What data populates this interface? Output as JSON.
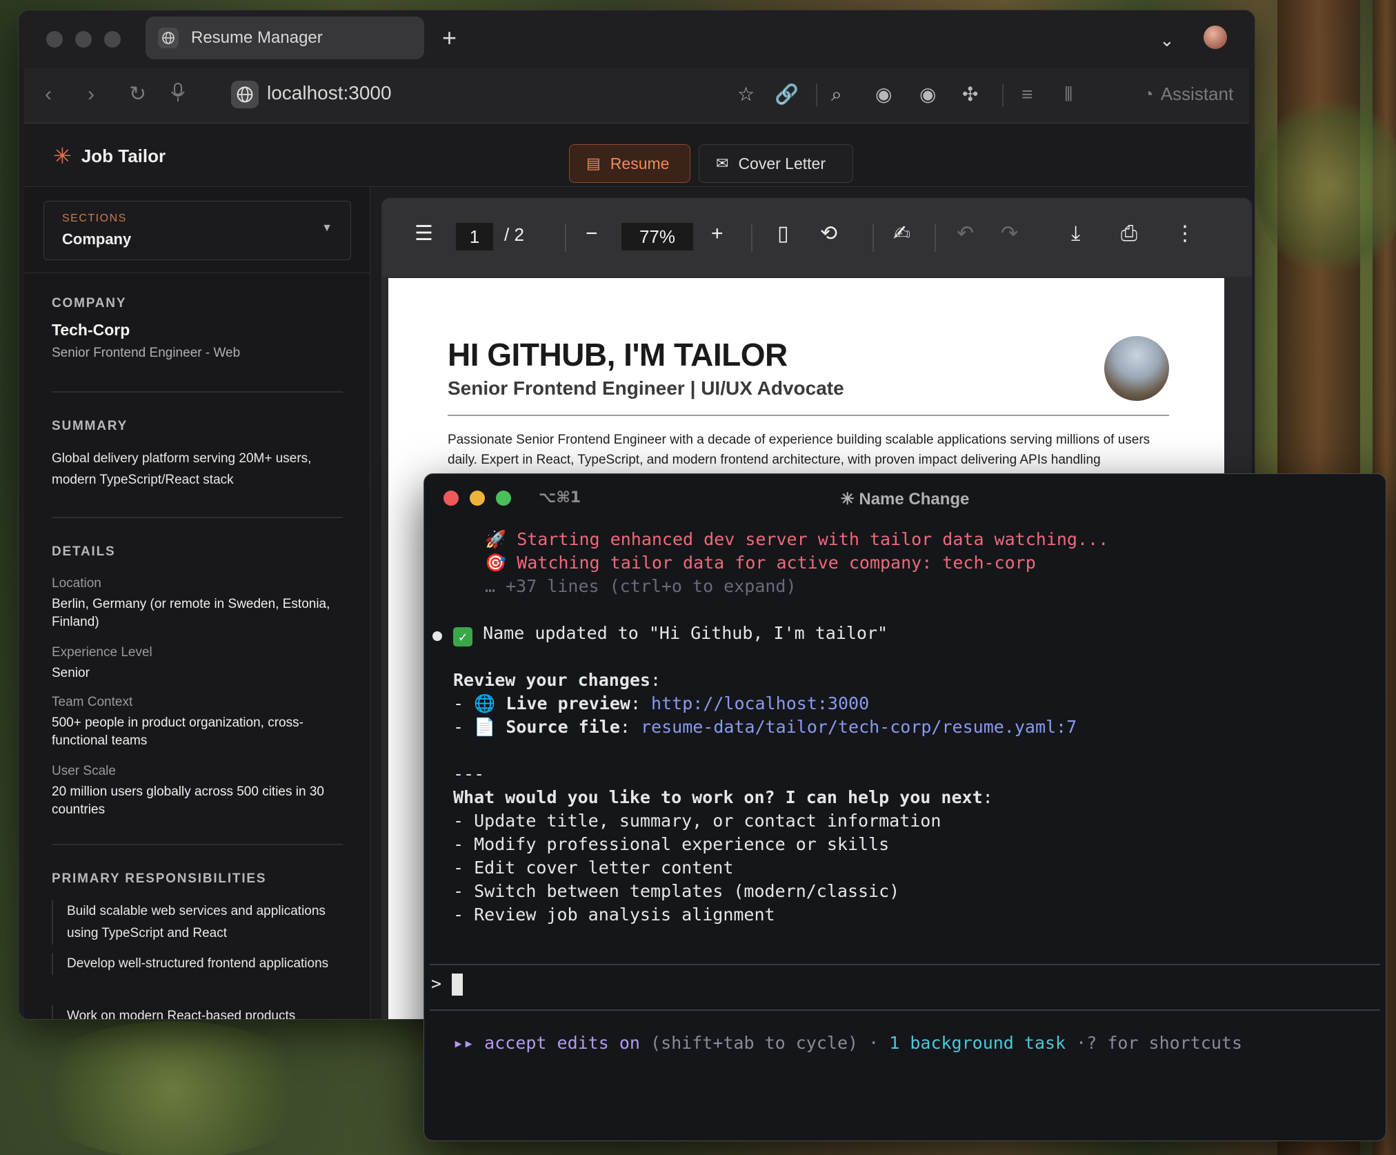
{
  "browser": {
    "tab_title": "Resume Manager",
    "new_tab": "+",
    "url": "localhost:3000",
    "assistant_label": "Assistant"
  },
  "app": {
    "brand": "Job Tailor",
    "tabs": {
      "resume": "Resume",
      "cover_letter": "Cover Letter"
    }
  },
  "sidebar": {
    "sections_label": "SECTIONS",
    "sections_value": "Company",
    "company_heading": "COMPANY",
    "company_name": "Tech-Corp",
    "company_role": "Senior Frontend Engineer - Web",
    "summary_heading": "SUMMARY",
    "summary_text": "Global delivery platform serving 20M+ users, modern TypeScript/React stack",
    "details_heading": "DETAILS",
    "details": [
      {
        "label": "Location",
        "value": "Berlin, Germany (or remote in Sweden, Estonia, Finland)"
      },
      {
        "label": "Experience Level",
        "value": "Senior"
      },
      {
        "label": "Team Context",
        "value": "500+ people in product organization, cross-functional teams"
      },
      {
        "label": "User Scale",
        "value": "20 million users globally across 500 cities in 30 countries"
      }
    ],
    "resp_heading": "PRIMARY RESPONSIBILITIES",
    "responsibilities": [
      "Build scalable web services and applications using TypeScript and React",
      "Develop well-structured frontend applications",
      "Work on modern React-based products"
    ]
  },
  "pdf": {
    "page_current": "1",
    "page_total": "/  2",
    "zoom": "77%",
    "name": "HI GITHUB, I'M TAILOR",
    "role": "Senior Frontend Engineer | UI/UX Advocate",
    "summary": "Passionate Senior Frontend Engineer with a decade of experience building scalable applications serving millions of users daily. Expert in React, TypeScript, and modern frontend architecture, with proven impact delivering APIs handling"
  },
  "terminal": {
    "shortcut": "⌥⌘1",
    "title": "✳ Name Change",
    "line1": "Starting enhanced dev server with tailor data watching...",
    "line2": "Watching tailor data for active company: tech-corp",
    "line3": "… +37 lines (ctrl+o to expand)",
    "line4": "Name updated to \"Hi Github, I'm tailor\"",
    "review_heading": "Review your changes",
    "review_colon": ":",
    "live_label": "Live preview",
    "live_url": "http://localhost:3000",
    "source_label": "Source file",
    "source_path": "resume-data/tailor/tech-corp/resume.yaml:7",
    "hr": "---",
    "next_heading": "What would you like to work on? I can help you next",
    "next_items": [
      "- Update title, summary, or contact information",
      "- Modify professional experience or skills",
      "- Edit cover letter content",
      "- Switch between templates (modern/classic)",
      "- Review job analysis alignment"
    ],
    "prompt": ">",
    "status_arrows": "▸▸",
    "status_accept": "accept edits on",
    "status_cycle": "(shift+tab to cycle)",
    "status_dot": "·",
    "status_bg": "1 background task",
    "status_help": "·? for shortcuts"
  },
  "colors": {
    "accent": "#e8724a",
    "terminal_red": "#ee6a7a",
    "link": "#8a9aee",
    "cyan": "#4ac8d8",
    "purple": "#b49aee"
  }
}
